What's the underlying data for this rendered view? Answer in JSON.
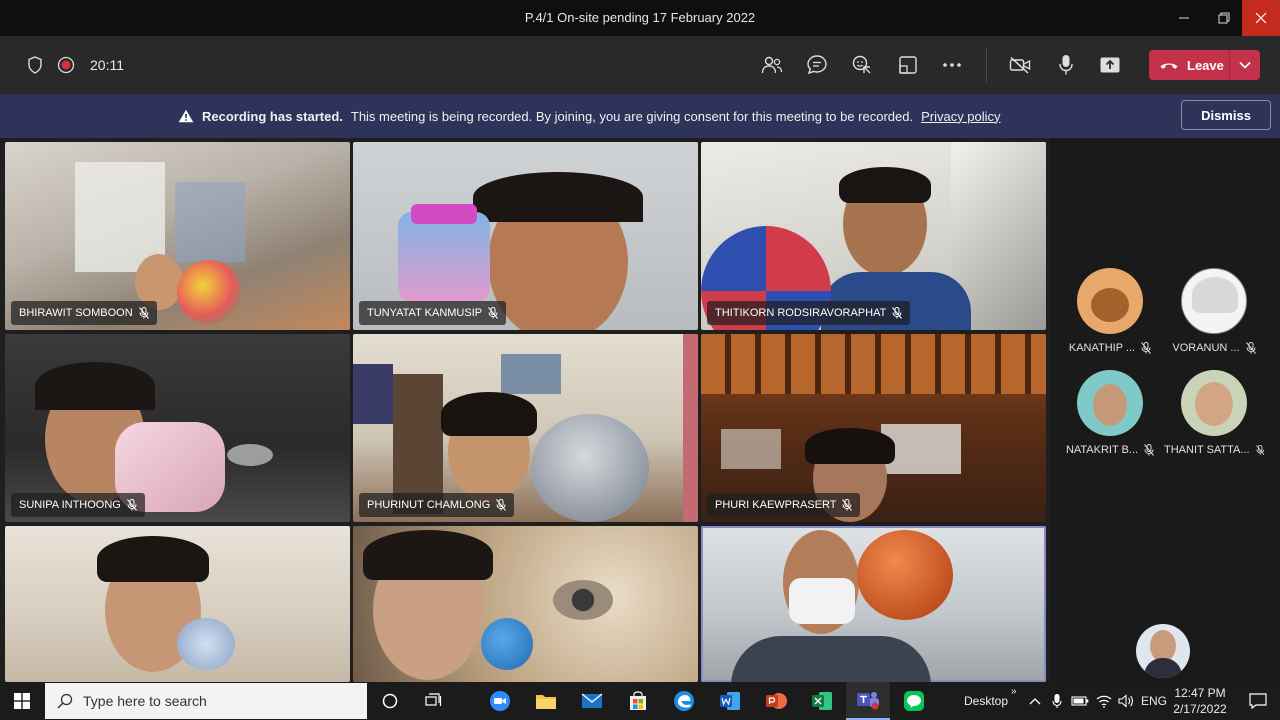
{
  "window": {
    "title": "P.4/1 On-site pending 17 February 2022"
  },
  "toolbar": {
    "timer": "20:11",
    "leave_label": "Leave",
    "icons": [
      "shield-icon",
      "record-icon",
      "people-icon",
      "chat-icon",
      "react-icon",
      "rooms-icon",
      "more-icon",
      "camera-off-icon",
      "mic-icon",
      "share-icon"
    ]
  },
  "banner": {
    "headline": "Recording has started.",
    "message": "This meeting is being recorded. By joining, you are giving consent for this meeting to be recorded.",
    "link": "Privacy policy",
    "dismiss_label": "Dismiss"
  },
  "tiles": [
    {
      "name": "BHIRAWIT SOMBOON"
    },
    {
      "name": "TUNYATAT KANMUSIP"
    },
    {
      "name": "THITIKORN RODSIRAVORAPHAT"
    },
    {
      "name": "SUNIPA INTHOONG"
    },
    {
      "name": "PHURINUT CHAMLONG"
    },
    {
      "name": "PHURI KAEWPRASERT"
    },
    {
      "name": ""
    },
    {
      "name": ""
    },
    {
      "name": ""
    }
  ],
  "roster": [
    {
      "name": "KANATHIP ..."
    },
    {
      "name": "VORANUN ..."
    },
    {
      "name": "NATAKRIT B..."
    },
    {
      "name": "THANIT SATTA..."
    }
  ],
  "taskbar": {
    "search_placeholder": "Type here to search",
    "desktop_label": "Desktop",
    "language": "ENG",
    "time": "12:47 PM",
    "date": "2/17/2022"
  }
}
